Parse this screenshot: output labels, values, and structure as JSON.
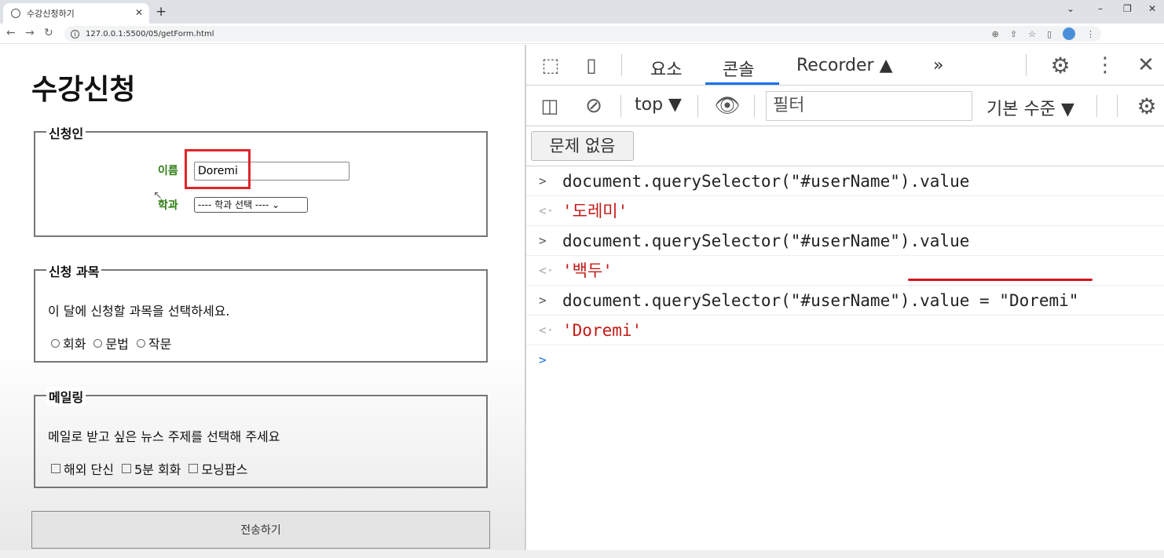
{
  "browser": {
    "tab_title": "수강신청하기",
    "tab_close": "✕",
    "new_tab": "+",
    "url": "127.0.0.1:5500/05/getForm.html",
    "controls": [
      "⌄",
      "–",
      "❐",
      "✕"
    ]
  },
  "form": {
    "title": "수강신청",
    "applicant": {
      "legend": "신청인",
      "name_label": "이름",
      "name_value": "Doremi",
      "dept_label": "학과",
      "dept_selected": "---- 학과 선택 ---- ⌄"
    },
    "courses": {
      "legend": "신청 과목",
      "instruction": "이 달에 신청할 과목을 선택하세요.",
      "options": [
        "회화",
        "문법",
        "작문"
      ]
    },
    "mailing": {
      "legend": "메일링",
      "instruction": "메일로 받고 싶은 뉴스 주제를 선택해 주세요",
      "options": [
        "해외 단신",
        "5분 회화",
        "모닝팝스"
      ]
    },
    "submit_label": "전송하기"
  },
  "devtools": {
    "tabs": [
      "요소",
      "콘솔",
      "Recorder ▲"
    ],
    "active_tab": "콘솔",
    "more": "»",
    "context": "top ▼",
    "filter_placeholder": "필터",
    "level": "기본 수준 ▼",
    "issues": "문제 없음",
    "console": [
      {
        "type": "input",
        "text": "document.querySelector(\"#userName\").value"
      },
      {
        "type": "output",
        "text": "'도레미'"
      },
      {
        "type": "input",
        "text": "document.querySelector(\"#userName\").value"
      },
      {
        "type": "output",
        "text": "'백두'"
      },
      {
        "type": "input",
        "text": "document.querySelector(\"#userName\").value = \"Doremi\""
      },
      {
        "type": "output",
        "text": "'Doremi'"
      }
    ]
  },
  "colors": {
    "label_green": "#2f7d14",
    "string_red": "#c41a16",
    "highlight_red": "#e0262b",
    "active_blue": "#1a73e8"
  }
}
